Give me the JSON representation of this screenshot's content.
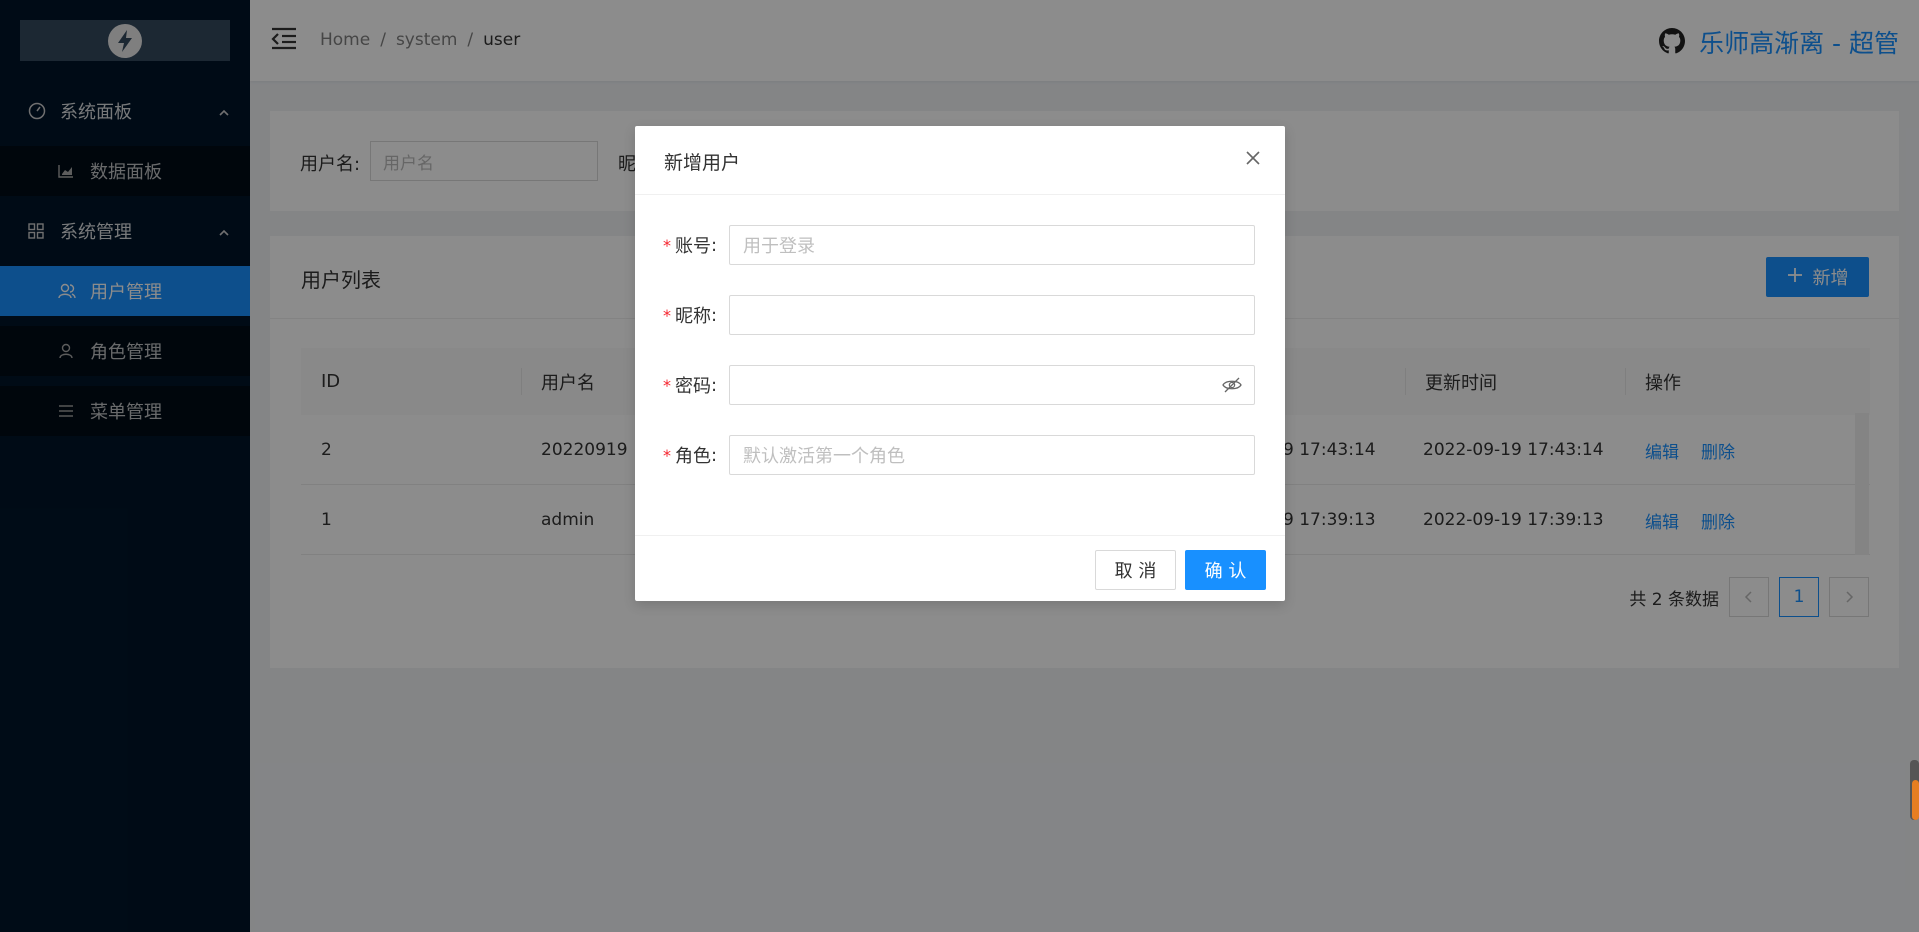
{
  "sidebar": {
    "groups": [
      {
        "label": "系统面板",
        "icon": "dashboard-icon",
        "items": [
          {
            "label": "数据面板",
            "icon": "chart-icon"
          }
        ]
      },
      {
        "label": "系统管理",
        "icon": "grid-icon",
        "items": [
          {
            "label": "用户管理",
            "icon": "users-icon"
          },
          {
            "label": "角色管理",
            "icon": "user-icon"
          },
          {
            "label": "菜单管理",
            "icon": "list-icon"
          }
        ]
      }
    ]
  },
  "header": {
    "breadcrumb": [
      "Home",
      "system",
      "user"
    ],
    "separator": "/",
    "username": "乐师高渐离 - 超管"
  },
  "search": {
    "username_label": "用户名:",
    "username_placeholder": "用户名",
    "nickname_label": "昵"
  },
  "list": {
    "title": "用户列表",
    "add_label": "新增",
    "columns": [
      "ID",
      "用户名",
      "更新时间",
      "操作"
    ],
    "rows": [
      {
        "id": "2",
        "username": "20220919",
        "created_tail": "9 17:43:14",
        "updated": "2022-09-19 17:43:14",
        "edit": "编辑",
        "delete": "删除"
      },
      {
        "id": "1",
        "username": "admin",
        "created_tail": "9 17:39:13",
        "updated": "2022-09-19 17:39:13",
        "edit": "编辑",
        "delete": "删除"
      }
    ],
    "total": "共 2 条数据",
    "current_page": "1"
  },
  "modal": {
    "title": "新增用户",
    "fields": [
      {
        "label": "账号",
        "placeholder": "用于登录",
        "required": true
      },
      {
        "label": "昵称",
        "placeholder": "",
        "required": true
      },
      {
        "label": "密码",
        "placeholder": "",
        "required": true
      },
      {
        "label": "角色",
        "placeholder": "默认激活第一个角色",
        "required": true
      }
    ],
    "cancel_label": "取 消",
    "ok_label": "确 认"
  },
  "colors": {
    "primary": "#1890ff",
    "sidebar_bg": "#001529",
    "required": "#f5222d"
  }
}
